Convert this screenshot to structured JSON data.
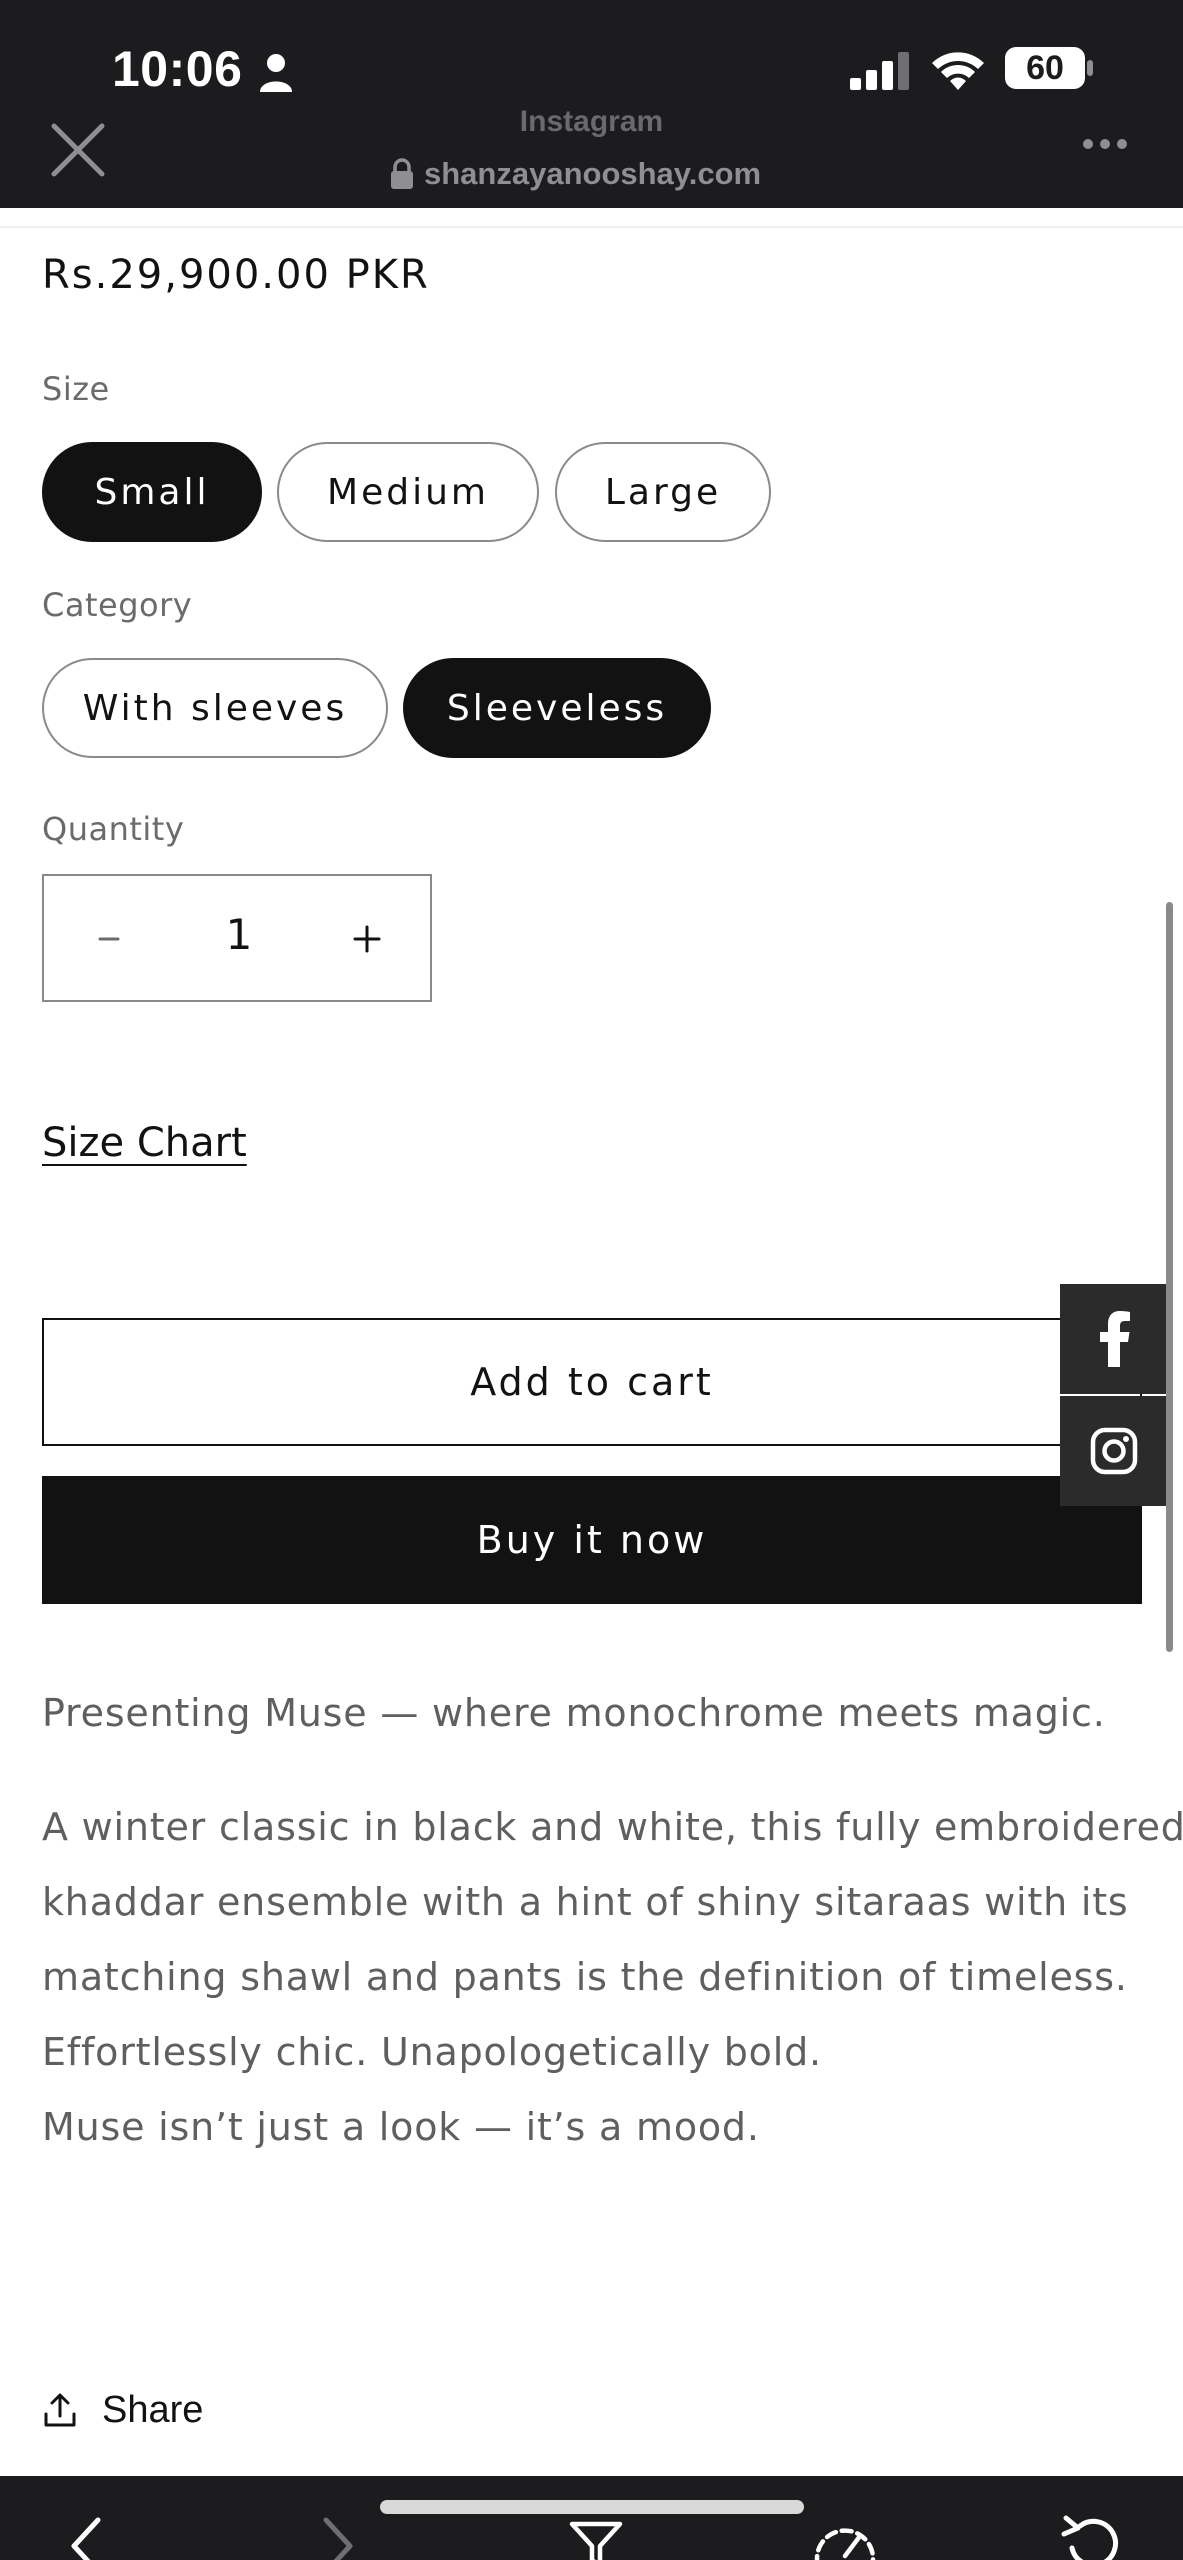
{
  "status_bar": {
    "time": "10:06",
    "battery": "60"
  },
  "browser": {
    "title_ghost": "Instagram",
    "url": "shanzayanooshay.com"
  },
  "product": {
    "price": "Rs.29,900.00 PKR",
    "size": {
      "label": "Size",
      "options": [
        "Small",
        "Medium",
        "Large"
      ],
      "selected": "Small"
    },
    "category": {
      "label": "Category",
      "options": [
        "With sleeves",
        "Sleeveless"
      ],
      "selected": "Sleeveless"
    },
    "quantity": {
      "label": "Quantity",
      "value": "1"
    },
    "size_chart_link": "Size Chart",
    "add_to_cart": "Add to cart",
    "buy_now": "Buy it now",
    "description": {
      "intro": "Presenting Muse — where monochrome meets magic.",
      "body_lines": [
        "A winter classic in black and white, this fully embroidered",
        "khaddar ensemble with a hint of shiny sitaraas with its",
        "matching shawl and pants is the definition of timeless.",
        "Effortlessly chic. Unapologetically bold.",
        "Muse isn’t just a look — it’s a mood."
      ]
    },
    "share_label": "Share"
  },
  "social": [
    "facebook-icon",
    "instagram-icon"
  ],
  "colors": {
    "primary": "#121212",
    "chrome": "#1c1c1e",
    "muted_text": "#5f5f5f",
    "border": "#8a8a8a"
  }
}
